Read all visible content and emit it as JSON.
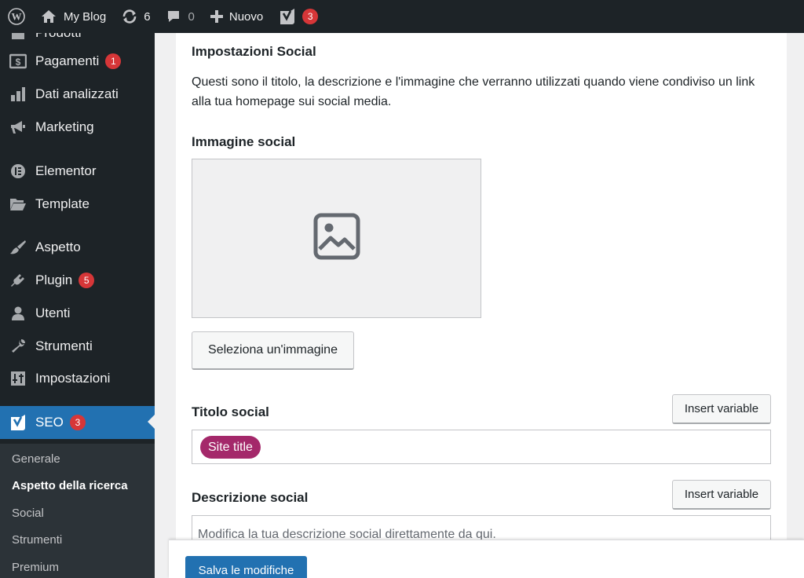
{
  "adminbar": {
    "wp_logo": "wordpress-icon",
    "site_name": "My Blog",
    "updates_count": "6",
    "comments_count": "0",
    "new_label": "Nuovo",
    "yoast_badge": "3"
  },
  "sidebar": {
    "partial_item": "Prodotti",
    "items": [
      {
        "label": "Pagamenti",
        "icon": "payments-icon",
        "badge": "1"
      },
      {
        "label": "Dati analizzati",
        "icon": "analytics-icon"
      },
      {
        "label": "Marketing",
        "icon": "megaphone-icon"
      },
      {
        "label": "Elementor",
        "icon": "elementor-icon"
      },
      {
        "label": "Template",
        "icon": "folder-icon"
      },
      {
        "label": "Aspetto",
        "icon": "brush-icon"
      },
      {
        "label": "Plugin",
        "icon": "plugin-icon",
        "badge": "5"
      },
      {
        "label": "Utenti",
        "icon": "users-icon"
      },
      {
        "label": "Strumenti",
        "icon": "wrench-icon"
      },
      {
        "label": "Impostazioni",
        "icon": "settings-icon"
      },
      {
        "label": "SEO",
        "icon": "yoast-icon",
        "badge": "3"
      }
    ],
    "submenu": [
      "Generale",
      "Aspetto della ricerca",
      "Social",
      "Strumenti",
      "Premium"
    ]
  },
  "content": {
    "section_title": "Impostazioni Social",
    "section_desc": "Questi sono il titolo, la descrizione e l'immagine che verranno utilizzati quando viene condiviso un link alla tua homepage sui social media.",
    "image_label": "Immagine social",
    "select_image_button": "Seleziona un'immagine",
    "title_label": "Titolo social",
    "insert_variable": "Insert variable",
    "title_pill": "Site title",
    "desc_label": "Descrizione social",
    "desc_placeholder": "Modifica la tua descrizione social direttamente da qui.",
    "save_button": "Salva le modifiche"
  },
  "colors": {
    "admin_dark": "#1d2327",
    "accent_blue": "#2271b1",
    "badge_red": "#d63638",
    "pill_purple": "#a4286a"
  }
}
